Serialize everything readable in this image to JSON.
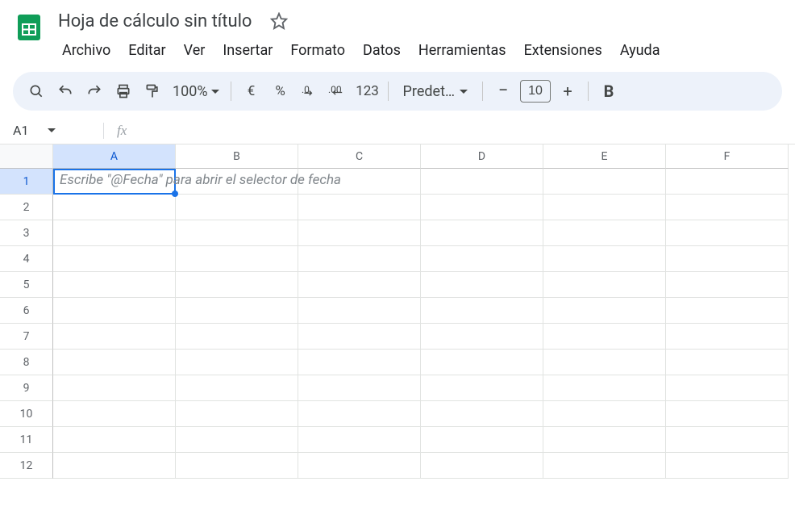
{
  "header": {
    "doc_title": "Hoja de cálculo sin título"
  },
  "menubar": {
    "items": [
      "Archivo",
      "Editar",
      "Ver",
      "Insertar",
      "Formato",
      "Datos",
      "Herramientas",
      "Extensiones",
      "Ayuda"
    ]
  },
  "toolbar": {
    "zoom": "100%",
    "currency": "€",
    "percent": "%",
    "dec_decrease": ".0←",
    "dec_increase": ".00→",
    "number_format": "123",
    "font_name": "Predet…",
    "font_size": "10",
    "bold": "B"
  },
  "formula_bar": {
    "cell_ref": "A1",
    "fx": "fx",
    "value": ""
  },
  "grid": {
    "columns": [
      "A",
      "B",
      "C",
      "D",
      "E",
      "F"
    ],
    "rows": [
      "1",
      "2",
      "3",
      "4",
      "5",
      "6",
      "7",
      "8",
      "9",
      "10",
      "11",
      "12"
    ],
    "selected": {
      "col": 0,
      "row": 0
    },
    "hint": "Escribe \"@Fecha\" para abrir el selector de fecha"
  }
}
